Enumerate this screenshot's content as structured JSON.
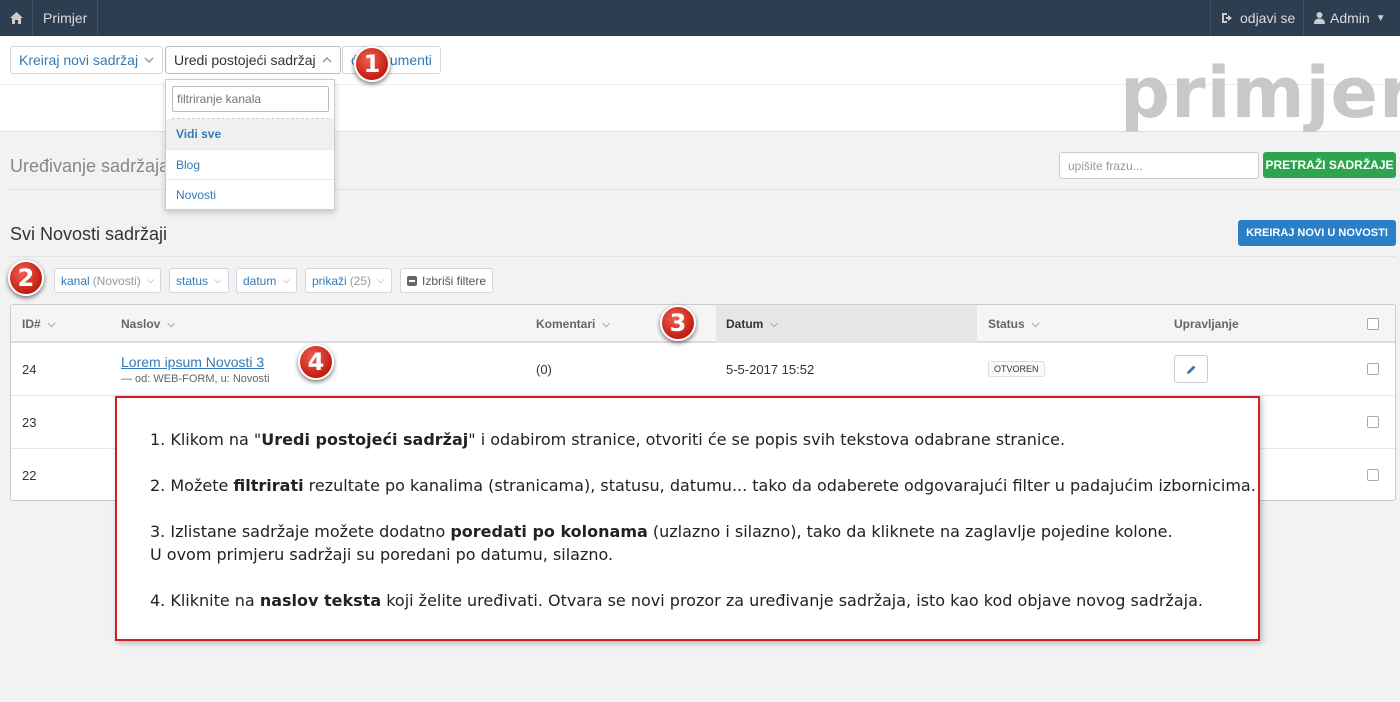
{
  "topbar": {
    "home_icon": "home-icon",
    "brand": "Primjer",
    "logout_label": "odjavi se",
    "admin_label": "Admin"
  },
  "toolbar": {
    "create_label": "Kreiraj novi sadržaj",
    "edit_label": "Uredi postojeći sadržaj",
    "docs_label": "ći Dokumenti",
    "logo_text": "primjer"
  },
  "dropdown": {
    "filter_placeholder": "filtriranje kanala",
    "items": [
      "Vidi sve",
      "Blog",
      "Novosti"
    ]
  },
  "page": {
    "heading": "Uređivanje sadržaja",
    "search_placeholder": "upišite frazu...",
    "search_button": "PRETRAŽI SADRŽAJE",
    "list_heading": "Svi Novosti sadržaji",
    "create_new_button": "KREIRAJ NOVI U NOVOSTI"
  },
  "filters": {
    "channel_label": "kanal",
    "channel_value": "(Novosti)",
    "status_label": "status",
    "date_label": "datum",
    "show_label": "prikaži",
    "show_value": "(25)",
    "clear_label": "Izbriši filtere"
  },
  "table": {
    "columns": [
      "ID#",
      "Naslov",
      "Komentari",
      "Datum",
      "Status",
      "Upravljanje"
    ],
    "rows": [
      {
        "id": "24",
        "title": "Lorem ipsum Novosti 3",
        "meta": "— od: WEB-FORM, u: Novosti",
        "comments": "(0)",
        "date": "5-5-2017 15:52",
        "status": "OTVOREN"
      },
      {
        "id": "23"
      },
      {
        "id": "22"
      }
    ]
  },
  "markers": [
    "1",
    "2",
    "3",
    "4"
  ],
  "instructions": {
    "p1_pre": "1. Klikom na \"",
    "p1_bold": "Uredi postojeći sadržaj",
    "p1_post": "\" i odabirom stranice, otvoriti će se popis svih tekstova odabrane stranice.",
    "p2_pre": "2. Možete ",
    "p2_bold": "filtrirati",
    "p2_post": " rezultate po kanalima (stranicama), statusu, datumu... tako da odaberete odgovarajući filter u padajućim izbornicima.",
    "p3_pre": "3. Izlistane sadržaje možete dodatno ",
    "p3_bold": "poredati po kolonama",
    "p3_post": " (uzlazno i silazno), tako da kliknete na zaglavlje pojedine kolone.",
    "p3_line2": "U ovom primjeru sadržaji su poredani po datumu, silazno.",
    "p4_pre": "4. Kliknite na ",
    "p4_bold": "naslov teksta",
    "p4_post": " koji želite uređivati. Otvara se novi prozor za uređivanje sadržaja, isto kao kod objave novog sadržaja."
  },
  "colors": {
    "navbar": "#2c3e50",
    "link": "#337ab7",
    "green": "#2ea44f",
    "blue_button": "#2a7fc6",
    "marker_red": "#d9261c",
    "box_border": "#d31f1f"
  }
}
